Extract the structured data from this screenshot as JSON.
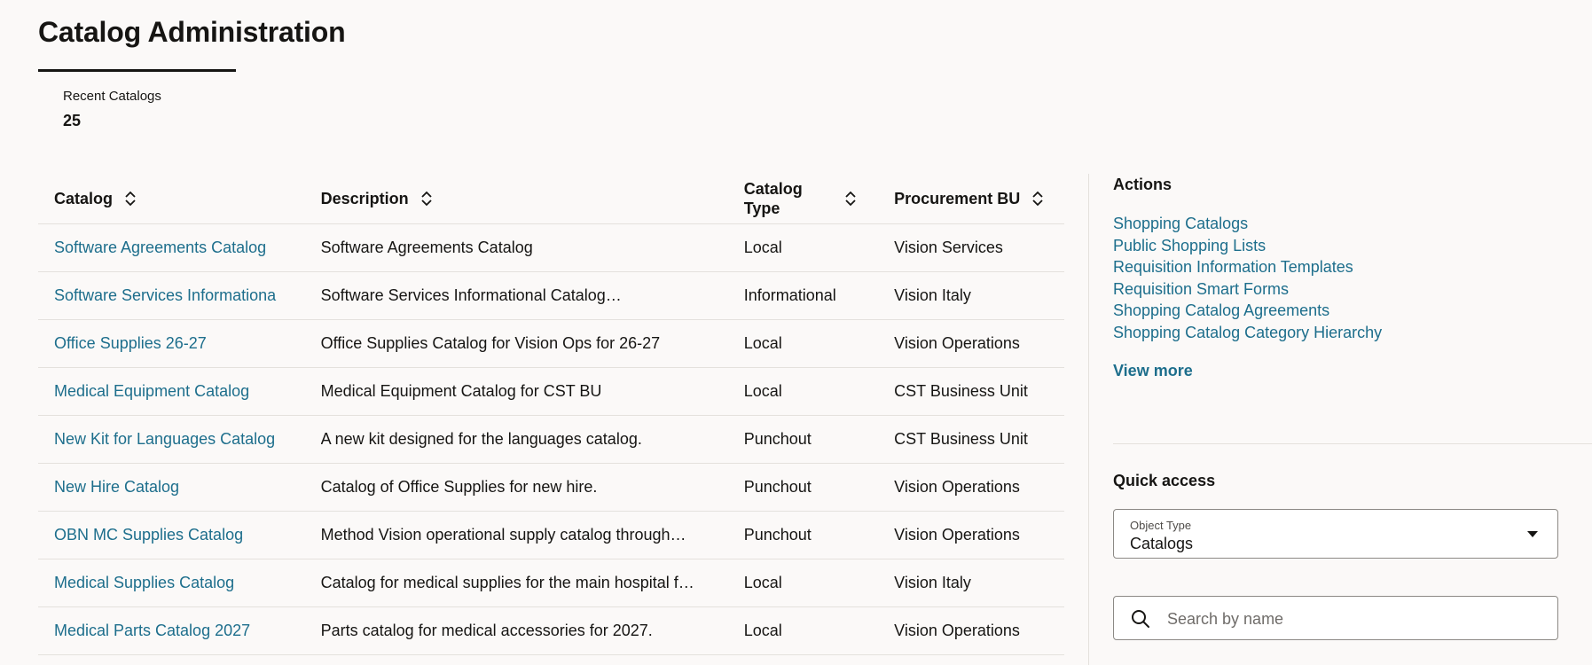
{
  "page": {
    "title": "Catalog Administration"
  },
  "metric": {
    "label": "Recent Catalogs",
    "value": "25"
  },
  "table": {
    "columns": [
      "Catalog",
      "Description",
      "Catalog Type",
      "Procurement BU"
    ],
    "rows": [
      {
        "catalog": "Software Agreements Catalog",
        "description": "Software Agreements Catalog",
        "type": "Local",
        "bu": "Vision Services"
      },
      {
        "catalog": "Software Services Informationa",
        "description": "Software Services Informational Catalog…",
        "type": "Informational",
        "bu": "Vision Italy"
      },
      {
        "catalog": "Office Supplies 26-27",
        "description": "Office Supplies Catalog for Vision Ops for 26-27",
        "type": "Local",
        "bu": "Vision Operations"
      },
      {
        "catalog": "Medical Equipment Catalog",
        "description": "Medical Equipment Catalog for CST BU",
        "type": "Local",
        "bu": "CST Business Unit"
      },
      {
        "catalog": "New Kit for Languages Catalog",
        "description": "A new kit designed for the languages catalog.",
        "type": "Punchout",
        "bu": "CST Business Unit"
      },
      {
        "catalog": "New Hire Catalog",
        "description": "Catalog of Office Supplies for new hire.",
        "type": "Punchout",
        "bu": "Vision Operations"
      },
      {
        "catalog": "OBN MC Supplies Catalog",
        "description": "Method Vision operational supply catalog through…",
        "type": "Punchout",
        "bu": "Vision Operations"
      },
      {
        "catalog": "Medical Supplies Catalog",
        "description": "Catalog for medical supplies for the main hospital f…",
        "type": "Local",
        "bu": "Vision Italy"
      },
      {
        "catalog": "Medical Parts Catalog 2027",
        "description": "Parts catalog for medical accessories for 2027.",
        "type": "Local",
        "bu": "Vision Operations"
      }
    ]
  },
  "actions": {
    "title": "Actions",
    "items": [
      "Shopping Catalogs",
      "Public Shopping Lists",
      "Requisition Information Templates",
      "Requisition Smart Forms",
      "Shopping Catalog Agreements",
      "Shopping Catalog Category Hierarchy"
    ],
    "view_more": "View more"
  },
  "quick_access": {
    "title": "Quick access",
    "object_type_label": "Object Type",
    "object_type_value": "Catalogs",
    "search_placeholder": "Search by name"
  },
  "colors": {
    "link": "#1d6e8c",
    "background": "#fbf9f8",
    "text": "#161513"
  }
}
